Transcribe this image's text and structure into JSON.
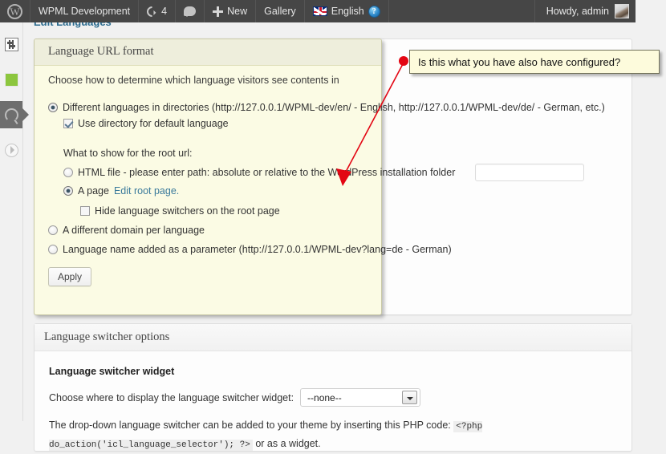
{
  "adminbar": {
    "logo_icon": "wordpress-logo-icon",
    "site_title": "WPML Development",
    "updates_icon": "refresh-icon",
    "updates_count": "4",
    "comments_icon": "comment-icon",
    "new_icon": "plus-icon",
    "new_label": "New",
    "gallery_label": "Gallery",
    "language_flag_icon": "uk-flag-icon",
    "language_label": "English",
    "help_icon": "help-icon",
    "howdy": "Howdy, admin",
    "avatar_icon": "avatar-icon"
  },
  "sidebar": {
    "items": [
      {
        "icon": "sliders-settings-icon",
        "active": false
      },
      {
        "icon": "green-square-icon",
        "active": false
      },
      {
        "icon": "wpml-globe-icon",
        "active": true
      },
      {
        "icon": "play-circle-icon",
        "active": false
      }
    ]
  },
  "page": {
    "edit_languages_link": "Edit Languages"
  },
  "url_format": {
    "title": "Language URL format",
    "intro": "Choose how to determine which language visitors see contents in",
    "options": [
      {
        "label": "Different languages in directories (http://127.0.0.1/WPML-dev/en/ - English, http://127.0.0.1/WPML-dev/de/ - German, etc.)",
        "selected": true
      },
      {
        "label": "A different domain per language",
        "selected": false
      },
      {
        "label": "Language name added as a parameter (http://127.0.0.1/WPML-dev?lang=de - German)",
        "selected": false
      }
    ],
    "use_directory_checkbox": {
      "label": "Use directory for default language",
      "checked": true
    },
    "root_url_heading": "What to show for the root url:",
    "root_options": [
      {
        "label": "HTML file - please enter path: absolute or relative to the WordPress installation folder",
        "selected": false
      },
      {
        "label": "A page",
        "link": "Edit root page.",
        "selected": true
      }
    ],
    "html_path_input_value": "",
    "hide_switchers_checkbox": {
      "label": "Hide language switchers on the root page",
      "checked": false
    },
    "apply_button": "Apply"
  },
  "switcher_options": {
    "title": "Language switcher options",
    "widget_heading": "Language switcher widget",
    "choose_label": "Choose where to display the language switcher widget:",
    "select_value": "--none--",
    "dropdown_icon": "chevron-down-icon",
    "php_text_before": "The drop-down language switcher can be added to your theme by inserting this PHP code:",
    "php_code": "<?php do_action('icl_language_selector'); ?>",
    "php_text_after": "or as a widget."
  },
  "annotation": {
    "text": "Is this what you have also have configured?",
    "dot_icon": "annotation-dot-icon",
    "arrow_icon": "annotation-arrow-icon",
    "color": "#e30613"
  }
}
